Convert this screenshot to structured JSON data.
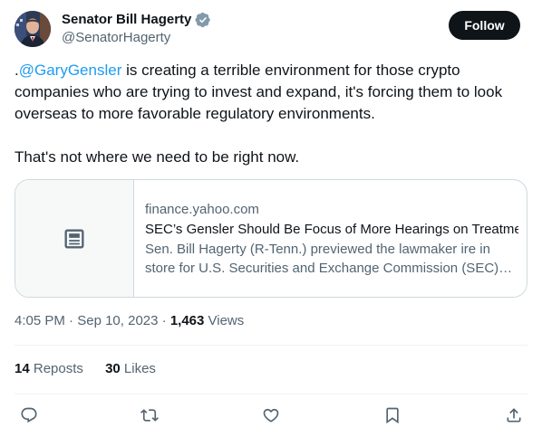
{
  "author": {
    "name": "Senator Bill Hagerty",
    "handle": "@SenatorHagerty",
    "verified_icon": "verified-badge-icon",
    "badge_color": "#829aab"
  },
  "follow_button": {
    "label": "Follow"
  },
  "tweet": {
    "prefix": ".",
    "mention": "@GaryGensler",
    "text_1": " is creating a terrible environment for those crypto companies who are trying to invest and expand, it's forcing them to look overseas to more favorable regulatory environments.",
    "text_2": "That's not where we need to be right now."
  },
  "link_card": {
    "domain": "finance.yahoo.com",
    "title": "SEC’s Gensler Should Be Focus of More Hearings on Treatment of Crypto",
    "description": "Sen. Bill Hagerty (R-Tenn.) previewed the lawmaker ire in store for U.S. Securities and Exchange Commission (SEC) Chair Gary Gensler during his upcoming appearance.",
    "thumb_icon": "article-icon"
  },
  "meta": {
    "time": "4:05 PM",
    "sep1": " · ",
    "date": "Sep 10, 2023",
    "sep2": " · ",
    "views_count": "1,463",
    "views_label": " Views"
  },
  "stats": {
    "reposts_count": "14",
    "reposts_label": " Reposts",
    "likes_count": "30",
    "likes_label": " Likes"
  },
  "actions": [
    "reply-icon",
    "repost-icon",
    "like-icon",
    "bookmark-icon",
    "share-icon"
  ],
  "colors": {
    "accent": "#1d9bf0",
    "text": "#0f1419",
    "secondary": "#536471",
    "border": "#cfd9de",
    "button_bg": "#0f1419"
  }
}
